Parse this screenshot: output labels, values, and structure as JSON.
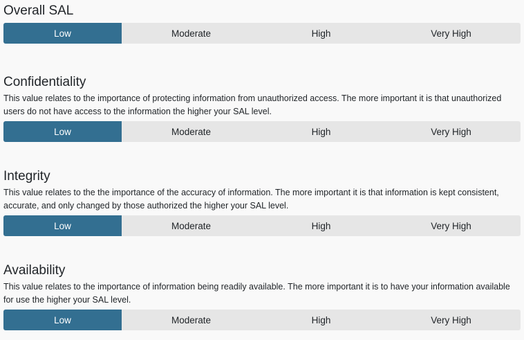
{
  "levels": [
    "Low",
    "Moderate",
    "High",
    "Very High"
  ],
  "colors": {
    "active_bg": "#336f91",
    "inactive_bg": "#e6e6e6",
    "page_bg": "#f9f9f9"
  },
  "overall": {
    "title": "Overall SAL",
    "selected": "Low"
  },
  "confidentiality": {
    "title": "Confidentiality",
    "description": "This value relates to the importance of protecting information from unauthorized access. The more important it is that unauthorized users do not have access to the information the higher your SAL level.",
    "selected": "Low"
  },
  "integrity": {
    "title": "Integrity",
    "description": "This value relates to the the importance of the accuracy of information. The more important it is that information is kept consistent, accurate, and only changed by those authorized the higher your SAL level.",
    "selected": "Low"
  },
  "availability": {
    "title": "Availability",
    "description": "This value relates to the importance of information being readily available. The more important it is to have your information available for use the higher your SAL level.",
    "selected": "Low"
  }
}
